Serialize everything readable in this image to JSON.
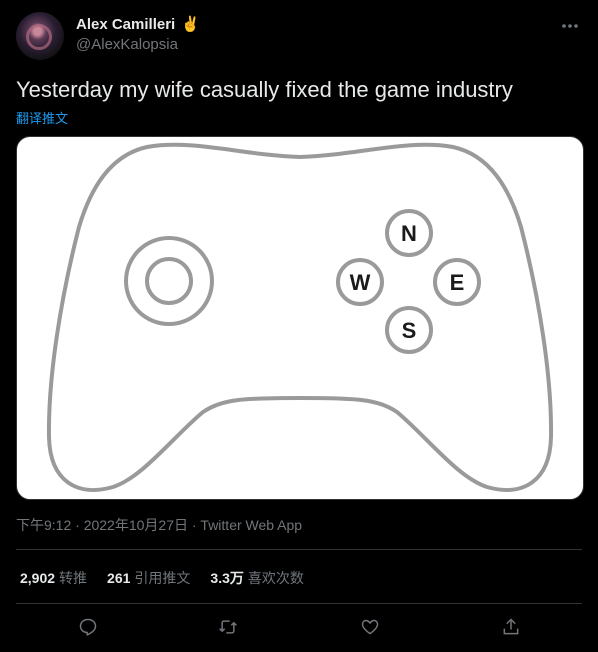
{
  "author": {
    "display_name": "Alex Camilleri",
    "emoji": "✌️",
    "handle": "@AlexKalopsia"
  },
  "tweet": {
    "text": "Yesterday my wife casually fixed the game industry",
    "translate_label": "翻译推文",
    "meta": "下午9:12 · 2022年10月27日 · Twitter Web App"
  },
  "media": {
    "button_labels": {
      "north": "N",
      "west": "W",
      "east": "E",
      "south": "S"
    }
  },
  "stats": [
    {
      "value": "2,902",
      "label": "转推"
    },
    {
      "value": "261",
      "label": "引用推文"
    },
    {
      "value": "3.3万",
      "label": "喜欢次数"
    }
  ],
  "actions": [
    "reply-icon",
    "retweet-icon",
    "like-icon",
    "share-icon"
  ],
  "colors": {
    "background": "#000000",
    "text": "#e7e9ea",
    "muted": "#71767b",
    "link": "#1d9bf0",
    "divider": "#2f3336"
  }
}
